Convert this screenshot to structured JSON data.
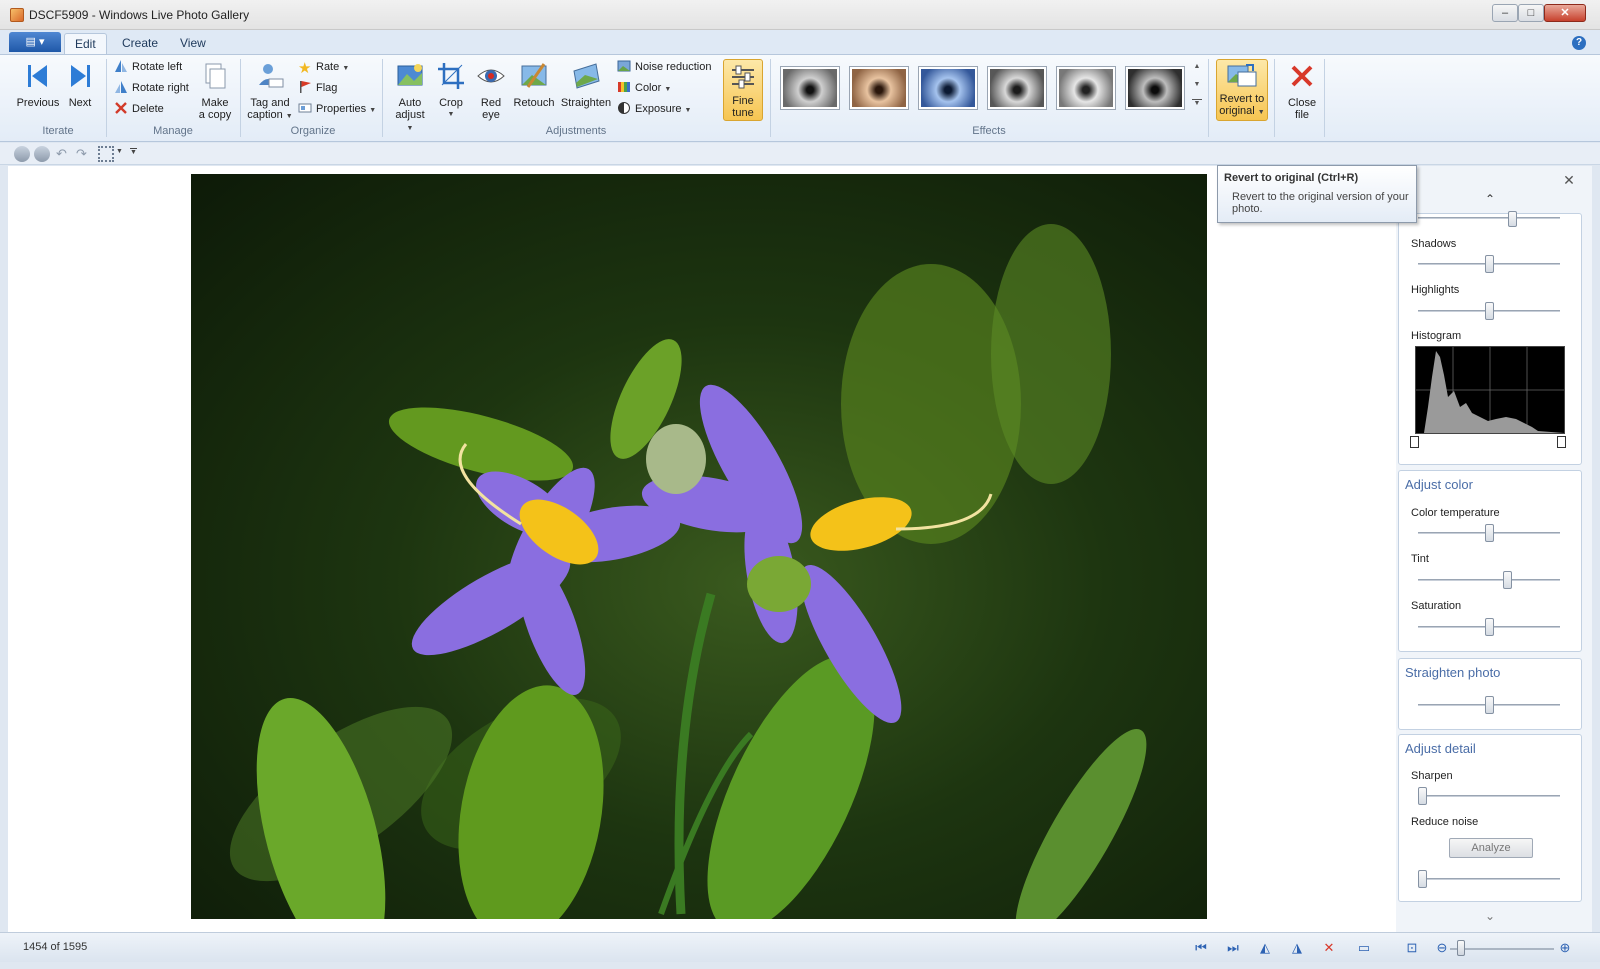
{
  "window": {
    "title": "DSCF5909 - Windows Live Photo Gallery",
    "min": "–",
    "max": "□",
    "close": "✕"
  },
  "tabs": {
    "app_menu": "▤ ▾",
    "edit": "Edit",
    "create": "Create",
    "view": "View",
    "help": "?"
  },
  "ribbon": {
    "iterate": {
      "label": "Iterate",
      "previous": "Previous",
      "next": "Next"
    },
    "manage": {
      "label": "Manage",
      "rotate_left": "Rotate left",
      "rotate_right": "Rotate right",
      "delete": "Delete",
      "make_copy_1": "Make",
      "make_copy_2": "a copy"
    },
    "organize": {
      "label": "Organize",
      "tag_1": "Tag and",
      "tag_2": "caption",
      "rate": "Rate",
      "flag": "Flag",
      "properties": "Properties"
    },
    "adjustments": {
      "label": "Adjustments",
      "auto_1": "Auto",
      "auto_2": "adjust",
      "crop": "Crop",
      "red_1": "Red",
      "red_2": "eye",
      "retouch": "Retouch",
      "straighten": "Straighten",
      "noise": "Noise reduction",
      "color": "Color",
      "exposure": "Exposure",
      "fine_1": "Fine",
      "fine_2": "tune"
    },
    "effects": {
      "label": "Effects"
    },
    "revert_1": "Revert to",
    "revert_2": "original",
    "close_1": "Close",
    "close_2": "file"
  },
  "tooltip": {
    "title": "Revert to original (Ctrl+R)",
    "body": "Revert to the original version of your photo."
  },
  "panel": {
    "close": "✕",
    "up": "⌃",
    "down": "⌄",
    "shadows": "Shadows",
    "highlights": "Highlights",
    "histogram": "Histogram",
    "adjust_color": "Adjust color",
    "color_temperature": "Color temperature",
    "tint": "Tint",
    "saturation": "Saturation",
    "straighten_photo": "Straighten photo",
    "adjust_detail": "Adjust detail",
    "sharpen": "Sharpen",
    "reduce_noise": "Reduce noise",
    "analyze": "Analyze"
  },
  "status": {
    "counter": "1454 of 1595"
  }
}
